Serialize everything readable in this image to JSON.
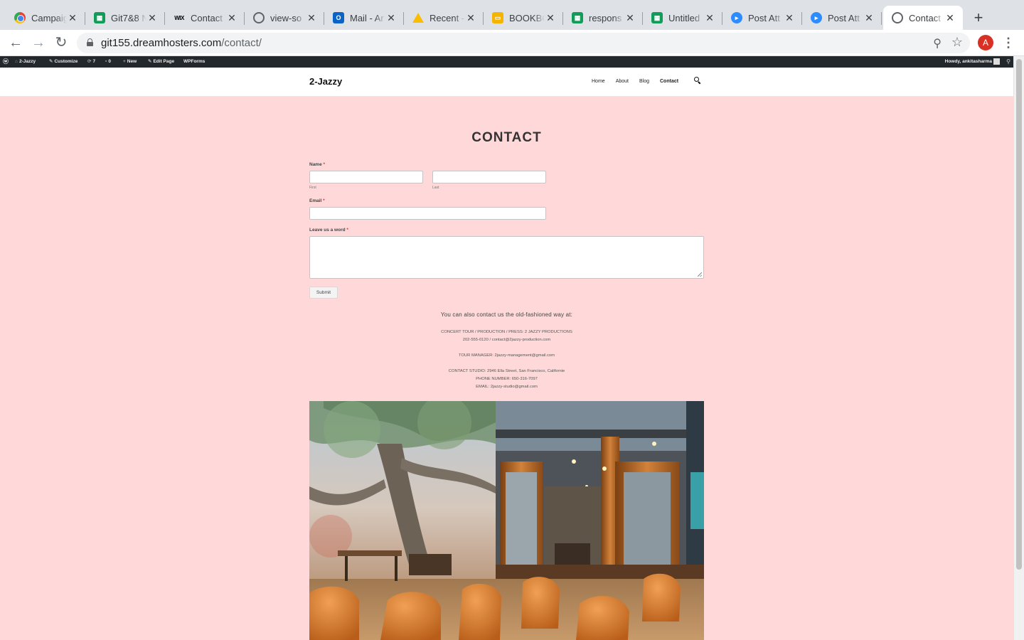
{
  "browser": {
    "tabs": [
      {
        "title": "Campaig",
        "icon": "chrome-icon",
        "active": false
      },
      {
        "title": "Git7&8 N",
        "icon": "sheets-icon",
        "active": false
      },
      {
        "title": "Contact",
        "icon": "wix-icon",
        "active": false
      },
      {
        "title": "view-so",
        "icon": "globe-icon",
        "active": false
      },
      {
        "title": "Mail - Ar",
        "icon": "outlook-icon",
        "active": false
      },
      {
        "title": "Recent -",
        "icon": "drive-icon",
        "active": false
      },
      {
        "title": "BOOKBO",
        "icon": "slides-icon",
        "active": false
      },
      {
        "title": "respons",
        "icon": "sheets-icon",
        "active": false
      },
      {
        "title": "Untitled",
        "icon": "sheets-icon",
        "active": false
      },
      {
        "title": "Post Att",
        "icon": "zoom-icon",
        "active": false
      },
      {
        "title": "Post Att",
        "icon": "zoom-icon",
        "active": false
      },
      {
        "title": "Contact",
        "icon": "globe-icon",
        "active": true
      }
    ],
    "url_domain": "git155.dreamhosters.com",
    "url_path": "/contact/",
    "profile_initial": "A"
  },
  "adminbar": {
    "site_name": "2-Jazzy",
    "customize": "Customize",
    "updates_count": "7",
    "comments_count": "0",
    "new": "New",
    "edit_page": "Edit Page",
    "wpforms": "WPForms",
    "howdy": "Howdy, ankitasharma"
  },
  "site": {
    "title": "2-Jazzy",
    "nav": [
      "Home",
      "About",
      "Blog",
      "Contact"
    ],
    "current_nav": "Contact"
  },
  "page": {
    "heading": "CONTACT",
    "form": {
      "name_label": "Name",
      "first_sublabel": "First",
      "last_sublabel": "Last",
      "email_label": "Email",
      "message_label": "Leave us a word",
      "required_mark": "*",
      "first_value": "",
      "last_value": "",
      "email_value": "",
      "message_value": "",
      "submit_label": "Submit"
    },
    "contact": {
      "lead": "You can also contact us the old-fashioned way at:",
      "lines": [
        "CONCERT TOUR / PRODUCTION / PRESS: 2 JAZZY PRODUCTIONS",
        "202-555-0120 / contact@2jazzy-production.com",
        "TOUR MANAGER: 2jazzy-management@gmail.com",
        "CONTACT STUDIO: 2946 Ella Street, San Francisco, Californie",
        "PHONE NUMBER: 650-316-7097",
        "EMAIL: 2jazzy-studio@gmail.com"
      ]
    }
  },
  "colors": {
    "page_background": "#ffd9d9",
    "admin_bar": "#23282d",
    "required": "#d63638"
  }
}
